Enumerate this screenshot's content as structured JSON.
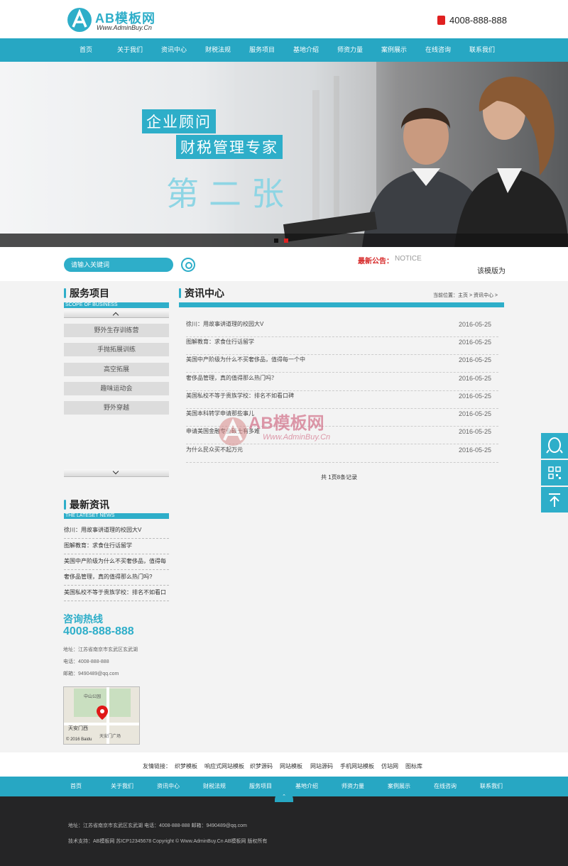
{
  "header": {
    "logo_text": "AB模板网",
    "logo_sub": "Www.AdminBuy.Cn",
    "phone": "4008-888-888"
  },
  "nav": [
    "首页",
    "关于我们",
    "资讯中心",
    "财税法规",
    "服务项目",
    "基地介绍",
    "师资力量",
    "案例展示",
    "在线咨询",
    "联系我们"
  ],
  "banner": {
    "slogan1": "企业顾问",
    "slogan2": "财税管理专家",
    "slogan3": "第二张"
  },
  "search": {
    "placeholder": "请输入关键词"
  },
  "notice": {
    "label": "最新公告：",
    "en": "NOTICE",
    "text": "该模版为"
  },
  "services": {
    "title": "服务项目",
    "sub": "SCOPE OF BUSINESS",
    "items": [
      "野外生存训练营",
      "手抛拓展训练",
      "高空拓展",
      "趣味运动会",
      "野外穿越"
    ]
  },
  "latest": {
    "title": "最新资讯",
    "sub": "THE LATESET NEWS",
    "items": [
      "徐川：用故事讲道理的校园大V",
      "图解教育：求食住行话留学",
      "美国中产阶级为什么不买奢侈品，值得每",
      "奢侈品管理，真的值得那么热门吗?",
      "美国私校不等于贵族学校：排名不如看口"
    ]
  },
  "hotline": {
    "title": "咨询热线",
    "number": "4008-888-888",
    "address": "地址：江苏省南京市玄武区玄武湖",
    "phone": "电话：4008-888-888",
    "email": "邮箱：9490489@qq.com",
    "map_label1": "中山公园",
    "map_label2": "天安门西",
    "map_label3": "天安门广场",
    "map_credit": "© 2016 Baidu"
  },
  "main": {
    "title": "资讯中心",
    "crumb_prefix": "当前位置：",
    "crumb_home": "主页",
    "crumb_current": "资讯中心",
    "rows": [
      {
        "title": "徐川：用故事讲道理的校园大V",
        "date": "2016-05-25"
      },
      {
        "title": "图解教育：求食住行话留学",
        "date": "2016-05-25"
      },
      {
        "title": "美国中产阶级为什么不买奢侈品，值得每一个中",
        "date": "2016-05-25"
      },
      {
        "title": "奢侈品管理，真的值得那么热门吗？",
        "date": "2016-05-25"
      },
      {
        "title": "美国私校不等于贵族学校：排名不如看口碑",
        "date": "2016-05-25"
      },
      {
        "title": "美国本科转学申请那些事儿",
        "date": "2016-05-25"
      },
      {
        "title": "申请美国金融专业硕士有多难",
        "date": "2016-05-25"
      },
      {
        "title": "为什么民众买不起万元",
        "date": "2016-05-25"
      }
    ],
    "pager": "共 1页8条记录",
    "watermark_text": "AB模板网",
    "watermark_sub": "Www.AdminBuy.Cn"
  },
  "links": {
    "label": "友情链接：",
    "items": [
      "织梦模板",
      "响应式网站模板",
      "织梦源码",
      "网站模板",
      "网站源码",
      "手机网站模板",
      "仿站网",
      "图标库"
    ]
  },
  "footer": {
    "nav": [
      "首页",
      "关于我们",
      "资讯中心",
      "财税法规",
      "服务项目",
      "基地介绍",
      "师资力量",
      "案例展示",
      "在线咨询",
      "联系我们"
    ],
    "top_label": "⌃",
    "line1": "地址：江苏省南京市玄武区玄武湖    电话：4008-888-888    邮箱：9490489@qq.com",
    "line2": "技术支持：AB模板网    苏ICP12345678    Copyright © Www.AdminBuy.Cn AB模板网 版权所有"
  },
  "colors": {
    "accent": "#27a7c3",
    "notice": "#d62828",
    "footer": "#252526"
  }
}
